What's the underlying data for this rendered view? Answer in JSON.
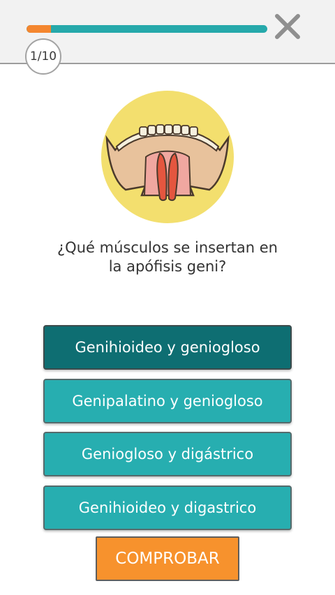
{
  "progress": {
    "counter_text": "1/10",
    "fraction": 0.1,
    "fill_color": "#f4862f",
    "track_color": "#26a9ab"
  },
  "close_icon": "close-icon",
  "illustration_icon": "mandible-illustration",
  "question": {
    "line1": "¿Qué músculos se insertan en",
    "line2": "la apófisis geni?"
  },
  "options": [
    {
      "label": "Genihioideo y geniogloso",
      "selected": true
    },
    {
      "label": "Genipalatino y geniogloso",
      "selected": false
    },
    {
      "label": "Geniogloso y digástrico",
      "selected": false
    },
    {
      "label": "Genihioideo y digastrico",
      "selected": false
    }
  ],
  "check_button": {
    "label": "COMPROBAR"
  },
  "colors": {
    "accent_teal": "#27aeb0",
    "selected_teal": "#0e6e72",
    "orange": "#f7922d"
  }
}
